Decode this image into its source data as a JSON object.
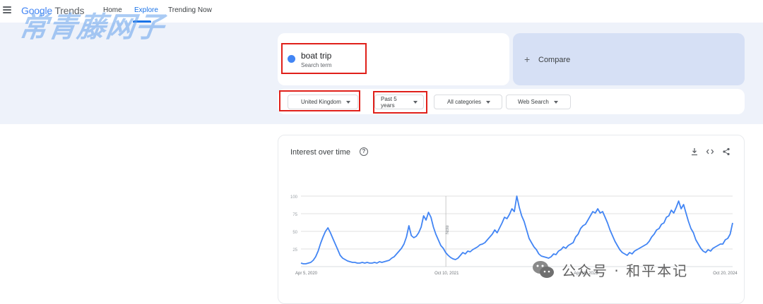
{
  "header": {
    "logo_google": "Google",
    "logo_trends": "Trends",
    "nav": [
      {
        "label": "Home"
      },
      {
        "label": "Explore"
      },
      {
        "label": "Trending Now"
      }
    ]
  },
  "watermark_top": "常青藤网子",
  "search": {
    "term": "boat trip",
    "term_type": "Search term",
    "term_color": "#4285f4",
    "compare_label": "Compare"
  },
  "filters": {
    "region": "United Kingdom",
    "time": "Past 5 years",
    "category": "All categories",
    "property": "Web Search"
  },
  "chart": {
    "title": "Interest over time",
    "note_label": "Note",
    "accent": "#4285f4"
  },
  "chart_data": {
    "type": "line",
    "title": "Interest over time",
    "x_tick_labels": [
      "Apr 5, 2020",
      "Oct 10, 2021",
      "Apr 16, 2023",
      "Oct 20, 2024"
    ],
    "y_ticks": [
      25,
      50,
      75,
      100
    ],
    "ylim": [
      0,
      100
    ],
    "grid": true,
    "series": [
      {
        "values": [
          5,
          4,
          4,
          5,
          6,
          9,
          14,
          22,
          33,
          42,
          50,
          55,
          48,
          40,
          32,
          24,
          16,
          12,
          10,
          8,
          7,
          6,
          6,
          5,
          5,
          6,
          5,
          6,
          5,
          5,
          6,
          5,
          7,
          6,
          7,
          8,
          9,
          12,
          14,
          18,
          22,
          26,
          32,
          42,
          58,
          44,
          41,
          43,
          48,
          56,
          72,
          66,
          77,
          70,
          56,
          46,
          38,
          30,
          26,
          20,
          16,
          13,
          11,
          10,
          12,
          16,
          20,
          18,
          22,
          21,
          24,
          26,
          28,
          31,
          32,
          34,
          38,
          42,
          46,
          52,
          48,
          55,
          62,
          70,
          68,
          74,
          82,
          78,
          100,
          84,
          72,
          64,
          52,
          40,
          34,
          28,
          24,
          18,
          15,
          14,
          13,
          12,
          14,
          18,
          17,
          22,
          24,
          28,
          26,
          30,
          32,
          34,
          42,
          46,
          54,
          58,
          60,
          66,
          72,
          78,
          76,
          82,
          76,
          78,
          70,
          62,
          52,
          44,
          36,
          30,
          24,
          20,
          18,
          16,
          20,
          18,
          22,
          24,
          26,
          28,
          30,
          32,
          36,
          42,
          46,
          52,
          54,
          60,
          62,
          70,
          72,
          80,
          76,
          84,
          93,
          82,
          88,
          76,
          64,
          54,
          48,
          38,
          32,
          26,
          22,
          20,
          24,
          22,
          26,
          28,
          30,
          32,
          32,
          38,
          40,
          46,
          62
        ]
      }
    ],
    "annotation": "Note"
  },
  "watermark_bottom": "公众号 · 和平本记"
}
